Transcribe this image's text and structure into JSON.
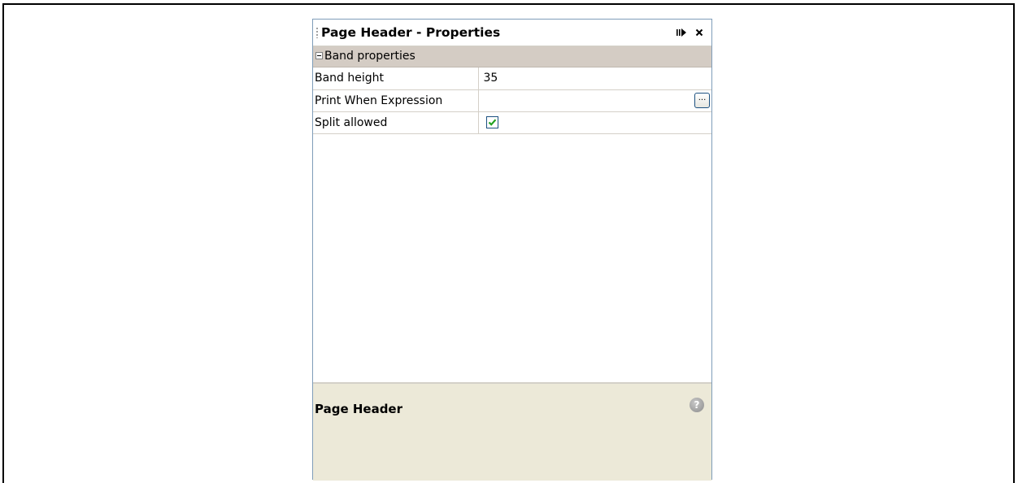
{
  "window": {
    "title": "Page Header - Properties",
    "minimize_icon": "minimize-icon",
    "close_icon": "close-icon"
  },
  "group": {
    "label": "Band properties",
    "expanded": true
  },
  "properties": [
    {
      "name": "Band height",
      "value": "35"
    },
    {
      "name": "Print When Expression",
      "value": "",
      "button": "..."
    },
    {
      "name": "Split allowed",
      "checked": true
    }
  ],
  "description": {
    "title": "Page Header",
    "help_icon": "question-icon",
    "help_glyph": "?"
  },
  "colors": {
    "check": "#21a121",
    "group_bg": "#d4ccc4",
    "desc_bg": "#ece9d8",
    "panel_border": "#7f9db9"
  }
}
